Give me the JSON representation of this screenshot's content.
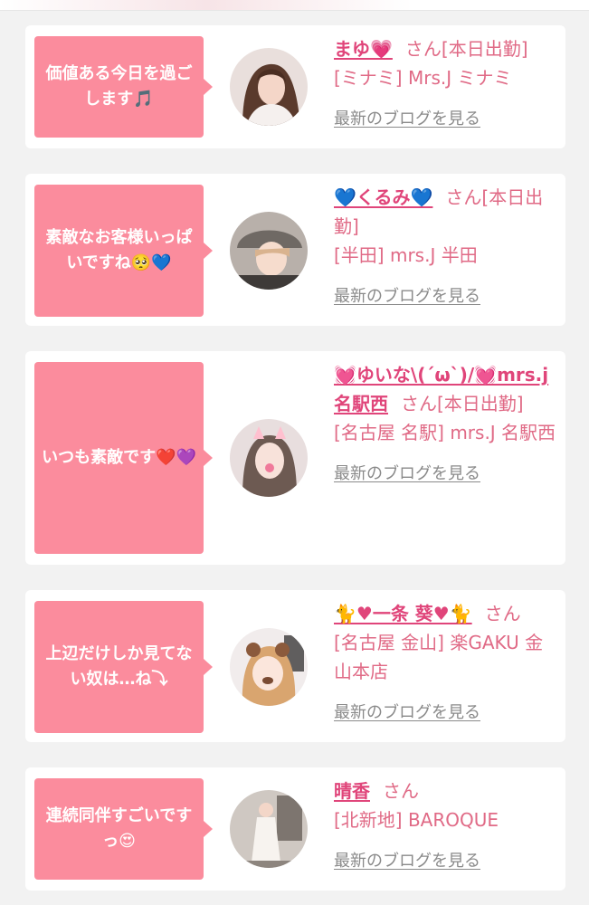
{
  "more_blog_label": "最新のブログを見る",
  "honorific": "さん",
  "colors": {
    "bubble": "#fb8c9d",
    "name": "#e0457a",
    "text_pink": "#e06a86",
    "link_gray": "#8a8a8a",
    "background": "#f2f2f2"
  },
  "cards": [
    {
      "message": "価値ある今日を過ごします🎵",
      "name": "まゆ💗",
      "status": "[本日出勤]",
      "shop": "[ミナミ] Mrs.J ミナミ",
      "avatar_icon": "avatar-photo-long-hair"
    },
    {
      "message": "素敵なお客様いっぱいですね🥺💙",
      "name": "💙くるみ💙",
      "status": "[本日出勤]",
      "shop": "[半田] mrs.J 半田",
      "avatar_icon": "avatar-photo-cap"
    },
    {
      "message": "いつも素敵です❤️💜",
      "name": "💓ゆいな\\(´ω`)/💓mrs.j名駅西",
      "status": "[本日出勤]",
      "shop": "[名古屋 名駅] mrs.J 名駅西",
      "avatar_icon": "avatar-photo-cat-filter"
    },
    {
      "message": "上辺だけしか見てない奴は…ね⤵",
      "name": "🐈♥一条 葵♥🐈",
      "status": "",
      "shop": "[名古屋 金山] 楽GAKU 金山本店",
      "avatar_icon": "avatar-photo-bear-filter"
    },
    {
      "message": "連続同伴すごいですっ😍",
      "name": "晴香",
      "status": "",
      "shop": "[北新地] BAROQUE",
      "avatar_icon": "avatar-photo-full-body"
    }
  ]
}
